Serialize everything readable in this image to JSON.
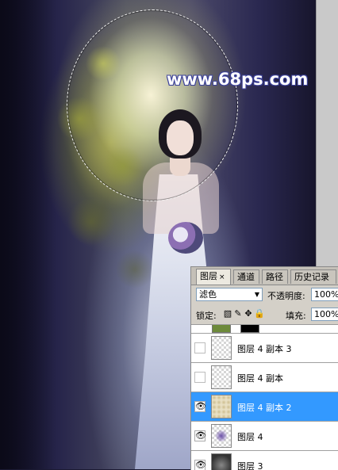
{
  "watermark": "www.68ps.com",
  "layers_panel": {
    "tabs": [
      {
        "label": "图层",
        "close": "×",
        "active": true
      },
      {
        "label": "通道",
        "active": false
      },
      {
        "label": "路径",
        "active": false
      },
      {
        "label": "历史记录",
        "active": false
      }
    ],
    "blend_mode": "滤色",
    "opacity_label": "不透明度:",
    "opacity_value": "100%",
    "lock_label": "锁定:",
    "fill_label": "填充:",
    "fill_value": "100%",
    "layers": [
      {
        "name": "图层 4 副本 3",
        "visible": false,
        "selected": false
      },
      {
        "name": "图层 4 副本",
        "visible": false,
        "selected": false
      },
      {
        "name": "图层 4 副本 2",
        "visible": true,
        "selected": true
      },
      {
        "name": "图层 4",
        "visible": true,
        "selected": false
      },
      {
        "name": "图层 3",
        "visible": true,
        "selected": false
      }
    ],
    "eye_glyph": "👁"
  }
}
